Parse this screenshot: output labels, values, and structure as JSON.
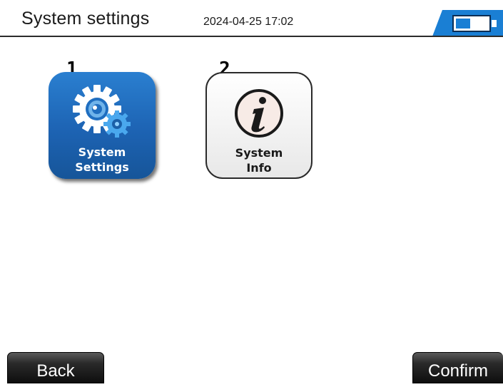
{
  "header": {
    "title": "System settings",
    "datetime": "2024-04-25 17:02",
    "battery_icon": "battery-icon",
    "accent_color": "#1a7fd4"
  },
  "tiles": [
    {
      "number": "1",
      "label_line1": "System",
      "label_line2": "Settings",
      "icon": "gear-icon",
      "selected": true,
      "color": "#1d63b3"
    },
    {
      "number": "2",
      "label_line1": "System",
      "label_line2": "Info",
      "icon": "info-icon",
      "selected": false,
      "color": "#f1f1f1"
    }
  ],
  "footer": {
    "back_label": "Back",
    "confirm_label": "Confirm"
  }
}
